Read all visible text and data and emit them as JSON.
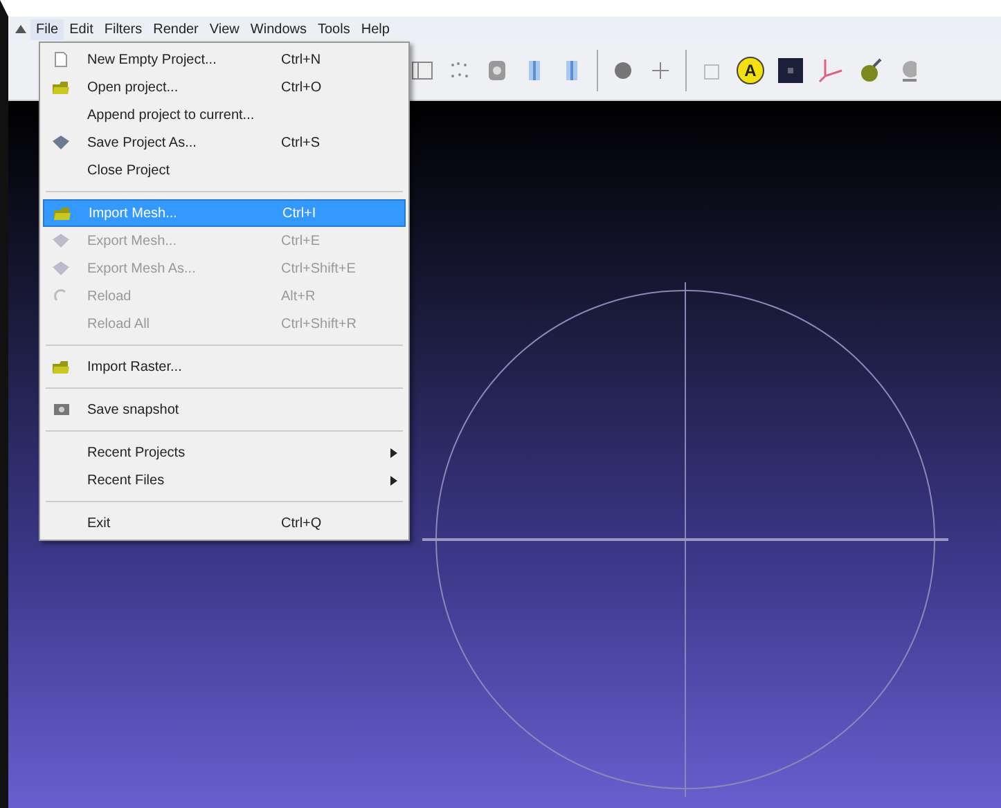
{
  "menubar": [
    {
      "label": "File",
      "selected": true
    },
    {
      "label": "Edit",
      "selected": false
    },
    {
      "label": "Filters",
      "selected": false
    },
    {
      "label": "Render",
      "selected": false
    },
    {
      "label": "View",
      "selected": false
    },
    {
      "label": "Windows",
      "selected": false
    },
    {
      "label": "Tools",
      "selected": false
    },
    {
      "label": "Help",
      "selected": false
    }
  ],
  "toolbar": [
    {
      "kind": "frame"
    },
    {
      "kind": "dots"
    },
    {
      "kind": "gear"
    },
    {
      "kind": "bar"
    },
    {
      "kind": "bar"
    },
    {
      "kind": "separator"
    },
    {
      "kind": "disk"
    },
    {
      "kind": "nodes"
    },
    {
      "kind": "separator"
    },
    {
      "kind": "cube"
    },
    {
      "kind": "badge",
      "glyph": "A"
    },
    {
      "kind": "square"
    },
    {
      "kind": "axes"
    },
    {
      "kind": "bulb"
    },
    {
      "kind": "globe"
    }
  ],
  "file_menu": [
    {
      "kind": "item",
      "label": "New Empty Project...",
      "shortcut": "Ctrl+N",
      "disabled": false,
      "selected": false,
      "submenu": false
    },
    {
      "kind": "item",
      "label": "Open project...",
      "shortcut": "Ctrl+O",
      "disabled": false,
      "selected": false,
      "submenu": false
    },
    {
      "kind": "item",
      "label": "Append project to current...",
      "disabled": false,
      "selected": false,
      "submenu": false
    },
    {
      "kind": "item",
      "label": "Save Project As...",
      "shortcut": "Ctrl+S",
      "disabled": false,
      "selected": false,
      "submenu": false
    },
    {
      "kind": "item",
      "label": "Close Project",
      "disabled": false,
      "selected": false,
      "submenu": false
    },
    {
      "kind": "separator"
    },
    {
      "kind": "item",
      "label": "Import Mesh...",
      "shortcut": "Ctrl+I",
      "disabled": false,
      "selected": true,
      "submenu": false
    },
    {
      "kind": "item",
      "label": "Export Mesh...",
      "shortcut": "Ctrl+E",
      "disabled": true,
      "selected": false,
      "submenu": false
    },
    {
      "kind": "item",
      "label": "Export Mesh As...",
      "shortcut": "Ctrl+Shift+E",
      "disabled": true,
      "selected": false,
      "submenu": false
    },
    {
      "kind": "item",
      "label": "Reload",
      "shortcut": "Alt+R",
      "disabled": true,
      "selected": false,
      "submenu": false
    },
    {
      "kind": "item",
      "label": "Reload All",
      "shortcut": "Ctrl+Shift+R",
      "disabled": true,
      "selected": false,
      "submenu": false
    },
    {
      "kind": "separator"
    },
    {
      "kind": "item",
      "label": "Import Raster...",
      "disabled": false,
      "selected": false,
      "submenu": false
    },
    {
      "kind": "separator"
    },
    {
      "kind": "item",
      "label": "Save snapshot",
      "disabled": false,
      "selected": false,
      "submenu": false
    },
    {
      "kind": "separator"
    },
    {
      "kind": "item",
      "label": "Recent Projects",
      "disabled": false,
      "selected": false,
      "submenu": true
    },
    {
      "kind": "item",
      "label": "Recent Files",
      "disabled": false,
      "selected": false,
      "submenu": true
    },
    {
      "kind": "separator"
    },
    {
      "kind": "item",
      "label": "Exit",
      "shortcut": "Ctrl+Q",
      "disabled": false,
      "selected": false,
      "submenu": false
    }
  ]
}
